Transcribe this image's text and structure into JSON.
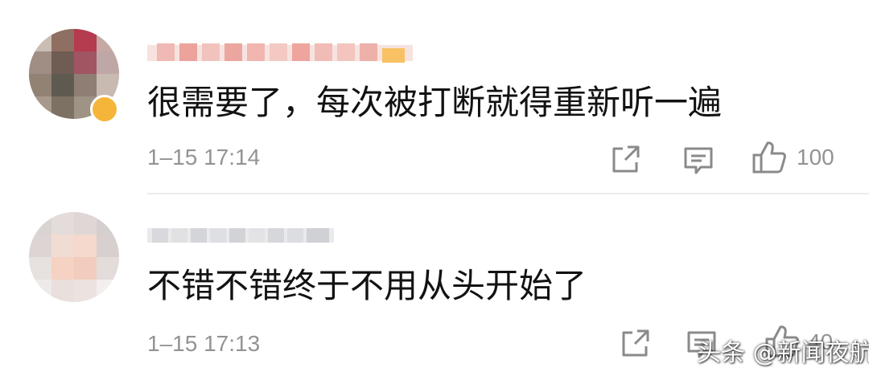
{
  "comments": [
    {
      "text": "很需要了，每次被打断就得重新听一遍",
      "timestamp": "1–15 17:14",
      "like_count": "100",
      "actions": [
        "share-icon",
        "reply-icon",
        "like-icon"
      ]
    },
    {
      "text": "不错不错终于不用从头开始了",
      "timestamp": "1–15 17:13",
      "like_count": "40",
      "actions": [
        "share-icon",
        "reply-icon",
        "like-icon"
      ]
    }
  ],
  "watermark": "头条 @新闻夜航",
  "colors": {
    "text": "#121212",
    "meta": "#939393",
    "icon": "#8a8a8a",
    "divider": "#ececec",
    "badge": "#f5b53b"
  }
}
